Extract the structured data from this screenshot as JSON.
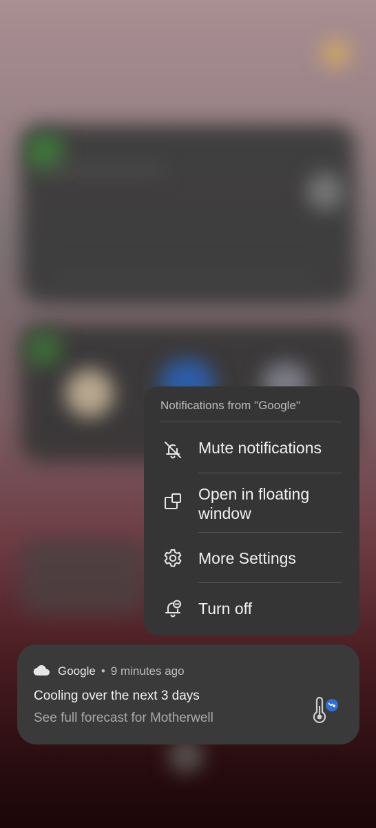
{
  "menu": {
    "title": "Notifications from \"Google\"",
    "items": [
      {
        "label": "Mute notifications",
        "icon": "bell-off-icon"
      },
      {
        "label": "Open in floating window",
        "icon": "floating-window-icon"
      },
      {
        "label": "More Settings",
        "icon": "gear-icon"
      },
      {
        "label": "Turn off",
        "icon": "bell-minus-icon"
      }
    ]
  },
  "notification": {
    "app_icon": "cloud-icon",
    "app_name": "Google",
    "separator": "•",
    "time": "9 minutes ago",
    "title": "Cooling over the next 3 days",
    "text": "See full forecast for Motherwell",
    "thumbnail_icon": "thermometer-down-icon"
  },
  "colors": {
    "menu_bg": "#353535",
    "card_bg": "#3a3a3a",
    "badge_blue": "#2f6fd6"
  }
}
